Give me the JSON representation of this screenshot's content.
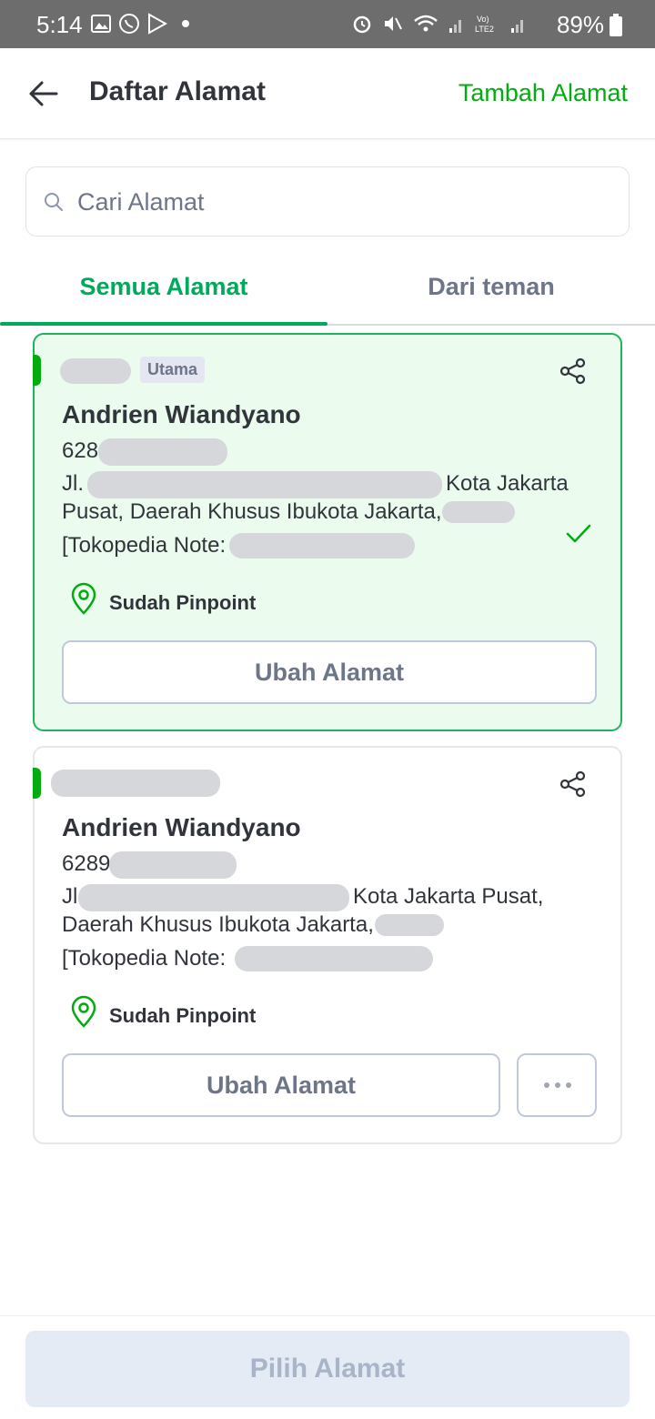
{
  "status_bar": {
    "time": "5:14",
    "battery": "89%"
  },
  "header": {
    "title": "Daftar Alamat",
    "add_label": "Tambah Alamat"
  },
  "search": {
    "placeholder": "Cari Alamat"
  },
  "tabs": [
    {
      "label": "Semua Alamat",
      "active": true
    },
    {
      "label": "Dari teman",
      "active": false
    }
  ],
  "addresses": [
    {
      "badge": "Utama",
      "name": "Andrien Wiandyano",
      "phone": "628",
      "line1_prefix": "Jl.",
      "line1_suffix": "Kota Jakarta",
      "line2": "Pusat, Daerah Khusus Ibukota Jakarta,",
      "note_prefix": "[Tokopedia Note:",
      "note_suffix": "]",
      "pinpoint": "Sudah Pinpoint",
      "edit_label": "Ubah Alamat",
      "selected": true
    },
    {
      "name": "Andrien Wiandyano",
      "phone": "6289",
      "line1_prefix": "Jl.",
      "line1_suffix": "Kota Jakarta Pusat,",
      "line2": "Daerah Khusus Ibukota Jakarta,",
      "note_prefix": "[Tokopedia Note:",
      "note_suffix": "]",
      "pinpoint": "Sudah Pinpoint",
      "edit_label": "Ubah Alamat",
      "selected": false
    }
  ],
  "footer": {
    "pick_label": "Pilih Alamat"
  },
  "colors": {
    "primary_green": "#03ac0e",
    "tab_green": "#00aa5b",
    "selected_bg": "#ebfcef",
    "disabled_btn": "#e4ebf5"
  }
}
